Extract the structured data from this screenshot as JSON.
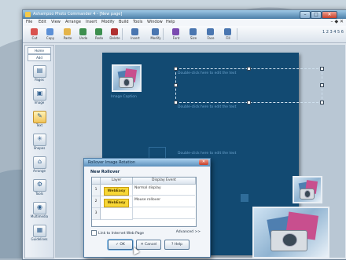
{
  "window": {
    "title": "Ashampoo Photo Commander 4 - [New page]",
    "controls": [
      "–",
      "□",
      "✕"
    ]
  },
  "menu": {
    "items": [
      "File",
      "Edit",
      "View",
      "Arrange",
      "Insert",
      "Modify",
      "Build",
      "Tools",
      "Window",
      "Help"
    ],
    "right": "– ◆ ✕"
  },
  "toolbar": {
    "buttons": [
      {
        "label": "Cut",
        "icon": "scissors-icon",
        "color": "#d9534f"
      },
      {
        "label": "Copy",
        "icon": "copy-icon",
        "color": "#5b8fd6"
      },
      {
        "label": "Paste",
        "icon": "paste-icon",
        "color": "#e4b44a"
      },
      {
        "label": "Undo",
        "icon": "undo-icon",
        "color": "#3d8f4f"
      },
      {
        "label": "Redo",
        "icon": "redo-icon",
        "color": "#3d8f4f"
      },
      {
        "label": "Delete",
        "icon": "delete-icon",
        "color": "#b03030"
      },
      {
        "label": "Insert",
        "icon": "insert-icon",
        "color": "#4a76b0"
      },
      {
        "label": "Modify",
        "icon": "modify-icon",
        "color": "#4a76b0"
      },
      {
        "label": "Font",
        "icon": "font-icon",
        "color": "#7a4ab0"
      },
      {
        "label": "Size",
        "icon": "size-icon",
        "color": "#4a76b0"
      },
      {
        "label": "Face",
        "icon": "face-icon",
        "color": "#4a76b0"
      },
      {
        "label": "Fill",
        "icon": "fill-icon",
        "color": "#4a76b0"
      }
    ],
    "right": "1 2 3 4 5 6"
  },
  "leftpanel": {
    "tabs": [
      "Home",
      "Add"
    ],
    "buttons": [
      {
        "label": "Pages",
        "glyph": "▤",
        "icon": "pages-icon"
      },
      {
        "label": "Image",
        "glyph": "▣",
        "icon": "image-icon"
      },
      {
        "label": "Text",
        "glyph": "✎",
        "icon": "text-icon",
        "selected": true
      },
      {
        "label": "Shapes",
        "glyph": "✳",
        "icon": "shapes-icon"
      },
      {
        "label": "Arrange",
        "glyph": "⌂",
        "icon": "arrange-icon"
      },
      {
        "label": "Tools",
        "glyph": "⚙",
        "icon": "tools-icon"
      },
      {
        "label": "Multimedia",
        "glyph": "◉",
        "icon": "multimedia-icon"
      },
      {
        "label": "Guidelines",
        "glyph": "▦",
        "icon": "guidelines-icon"
      }
    ]
  },
  "canvas": {
    "image_caption": "Image Caption",
    "text_placeholder_1": "Double-click here to edit the text",
    "text_placeholder_2": "Double-click here to edit the text",
    "text_placeholder_3": "Double-click here to edit the text"
  },
  "dialog": {
    "title": "Rollover Image Rotation",
    "heading": "New Rollover",
    "columns": [
      "Layer",
      "Display Event"
    ],
    "rows": [
      {
        "num": "1",
        "layer": "WebEasy",
        "event": "Normal display"
      },
      {
        "num": "2",
        "layer": "WebEasy",
        "event": "Mouse rollover"
      },
      {
        "num": "3",
        "layer": "",
        "event": ""
      }
    ],
    "checkbox_label": "Link to Internet Web Page",
    "advanced_label": "Advanced >>",
    "buttons": {
      "ok": "✓ OK",
      "cancel": "✕ Cancel",
      "help": "? Help"
    }
  }
}
